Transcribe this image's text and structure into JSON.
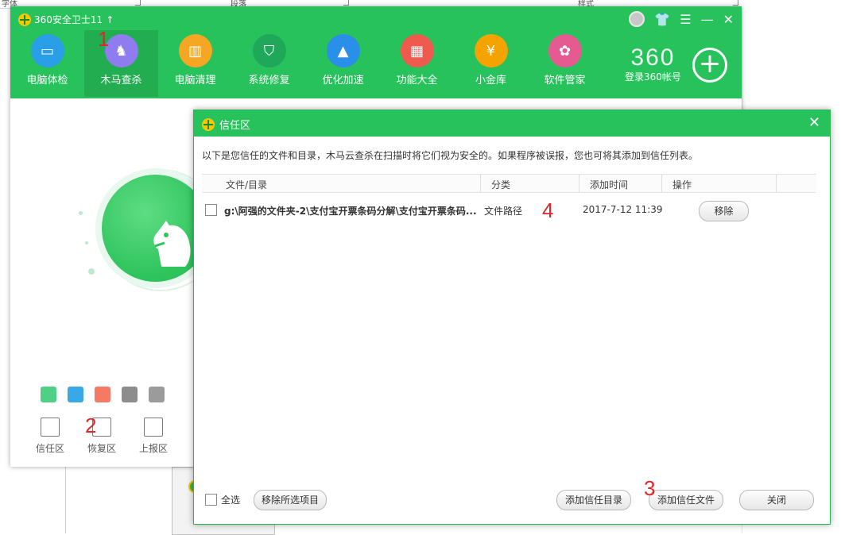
{
  "background": {
    "ruler_labels": [
      "字体",
      "段落",
      "样式"
    ]
  },
  "app": {
    "title": "360安全卫士11",
    "title_arrow": "↑",
    "nav": [
      {
        "label": "电脑体检",
        "icon": "monitor-icon",
        "color": "#2a9fe8"
      },
      {
        "label": "木马查杀",
        "icon": "horse-icon",
        "color": "#8f7df0"
      },
      {
        "label": "电脑清理",
        "icon": "broom-icon",
        "color": "#f5a623"
      },
      {
        "label": "系统修复",
        "icon": "shield-icon",
        "color": "#1fa85a"
      },
      {
        "label": "优化加速",
        "icon": "rocket-icon",
        "color": "#2a8fe8"
      },
      {
        "label": "功能大全",
        "icon": "grid-icon",
        "color": "#ef5a4f"
      },
      {
        "label": "小金库",
        "icon": "coin-icon",
        "color": "#f5a300"
      },
      {
        "label": "软件管家",
        "icon": "apps-icon",
        "color": "#e65a92"
      }
    ],
    "brand_text": "360",
    "login_label": "登录360帐号",
    "zones": [
      {
        "label": "信任区"
      },
      {
        "label": "恢复区"
      },
      {
        "label": "上报区"
      }
    ],
    "mini_icon_colors": [
      "#4fd085",
      "#3aa8e8",
      "#f47a63",
      "#8d8d8d",
      "#9b9b9b"
    ]
  },
  "annotations": [
    "1",
    "2",
    "3",
    "4"
  ],
  "dialog": {
    "title": "信任区",
    "description": "以下是您信任的文件和目录，木马云查杀在扫描时将它们视为安全的。如果程序被误报，您也可将其添加到信任列表。",
    "columns": [
      "文件/目录",
      "分类",
      "添加时间",
      "操作"
    ],
    "rows": [
      {
        "path": "g:\\阿强的文件夹-2\\支付宝开票条码分解\\支付宝开票条码...",
        "category": "文件路径",
        "time": "2017-7-12 11:39",
        "action": "移除"
      }
    ],
    "select_all": "全选",
    "remove_selected": "移除所选项目",
    "add_dir": "添加信任目录",
    "add_file": "添加信任文件",
    "close": "关闭"
  },
  "colors": {
    "brand_green": "#27c25c",
    "annotation_red": "#e0262b"
  }
}
